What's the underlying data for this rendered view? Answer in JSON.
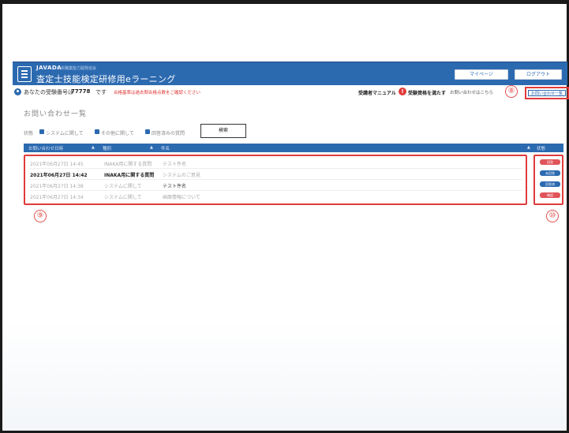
{
  "header": {
    "brand_small": "JAVADA",
    "brand_sub": "中央職業能力開発協会",
    "title": "査定士技能検定研修用eラーニング",
    "btn_mypage": "マイページ",
    "btn_logout": "ログアウト"
  },
  "subbar": {
    "user_prefix": "あなたの受験番号は",
    "user_id": "77778",
    "user_suffix": "です",
    "red_notice": "合格基準は過去問合格点数をご確認ください",
    "manual_label": "受講者マニュアル",
    "warn_label": "受験資格を満たす",
    "contact_label": "お問い合わせはこちら"
  },
  "markers": {
    "m8": "⑧",
    "m9": "⑨",
    "m10": "⑩"
  },
  "inquiry_button": "お問い合わせ一覧",
  "page_title": "お問い合わせ一覧",
  "filters": {
    "label": "状態",
    "option1": "システムに関して",
    "option2": "その他に関して",
    "option3": "回答済みの質問",
    "search_button": "検索"
  },
  "table": {
    "columns": [
      "お問い合わせ日時",
      "種別",
      "件名",
      "状態"
    ],
    "rows": [
      {
        "date": "2021年06月27日 14:45",
        "type": "INAKA用に関する質問",
        "subject": "テスト件名",
        "style": "faded",
        "action": "回答"
      },
      {
        "date": "2021年06月27日 14:42",
        "type": "INAKA用に関する質問",
        "subject": "システムのご意見",
        "style": "bold",
        "action": "未回答"
      },
      {
        "date": "2021年06月27日 14:38",
        "type": "システムに関して",
        "subject": "テスト件名",
        "style": "faded",
        "action": "回答済"
      },
      {
        "date": "2021年06月27日 14:34",
        "type": "システムに関して",
        "subject": "画面情報について",
        "style": "faded",
        "action": "確認"
      }
    ]
  },
  "colors": {
    "primary": "#2c6ab0",
    "highlight_red": "#e03b3b",
    "action_red": "#e0555a",
    "action_blue": "#2c6ab0"
  }
}
